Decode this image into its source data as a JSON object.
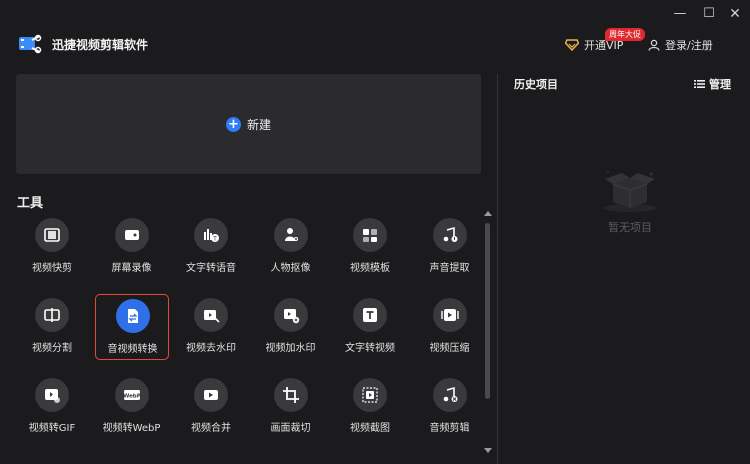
{
  "window": {
    "minimize_icon": "minimize-icon",
    "close_icon": "close-icon"
  },
  "header": {
    "app_title": "迅捷视频剪辑软件",
    "vip_label": "开通VIP",
    "vip_badge": "周年大促",
    "login_label": "登录/注册"
  },
  "new_project": {
    "label": "新建"
  },
  "tools_section": {
    "title": "工具"
  },
  "tools": [
    {
      "label": "视频快剪",
      "icon": "film-icon"
    },
    {
      "label": "屏幕录像",
      "icon": "camera-icon"
    },
    {
      "label": "文字转语音",
      "icon": "text-to-speech-icon"
    },
    {
      "label": "人物抠像",
      "icon": "person-cutout-icon"
    },
    {
      "label": "视频模板",
      "icon": "template-icon"
    },
    {
      "label": "声音提取",
      "icon": "music-extract-icon"
    },
    {
      "label": "视频分割",
      "icon": "split-icon"
    },
    {
      "label": "音视频转换",
      "icon": "convert-icon",
      "selected": true
    },
    {
      "label": "视频去水印",
      "icon": "remove-watermark-icon"
    },
    {
      "label": "视频加水印",
      "icon": "add-watermark-icon"
    },
    {
      "label": "文字转视频",
      "icon": "text-to-video-icon"
    },
    {
      "label": "视频压缩",
      "icon": "compress-icon"
    },
    {
      "label": "视频转GIF",
      "icon": "gif-icon"
    },
    {
      "label": "视频转WebP",
      "icon": "webp-icon"
    },
    {
      "label": "视频合并",
      "icon": "merge-icon"
    },
    {
      "label": "画面裁切",
      "icon": "crop-icon"
    },
    {
      "label": "视频截图",
      "icon": "screenshot-icon"
    },
    {
      "label": "音频剪辑",
      "icon": "audio-edit-icon"
    }
  ],
  "history": {
    "title": "历史项目",
    "manage_label": "管理",
    "empty_text": "暂无项目"
  },
  "colors": {
    "accent": "#2f7cf6",
    "selected_border": "#e8473b",
    "badge": "#e0292e",
    "vip_gold": "#e7b449"
  }
}
